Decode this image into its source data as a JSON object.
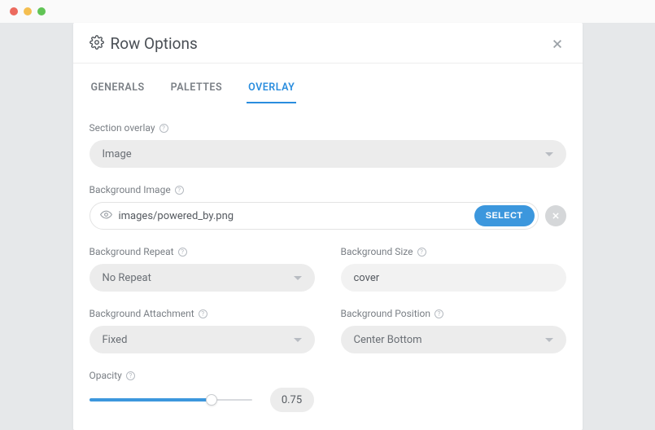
{
  "header": {
    "title": "Row Options"
  },
  "tabs": [
    {
      "label": "GENERALS",
      "active": false
    },
    {
      "label": "PALETTES",
      "active": false
    },
    {
      "label": "OVERLAY",
      "active": true
    }
  ],
  "fields": {
    "section_overlay": {
      "label": "Section overlay",
      "value": "Image"
    },
    "background_image": {
      "label": "Background Image",
      "value": "images/powered_by.png",
      "select_label": "SELECT"
    },
    "background_repeat": {
      "label": "Background Repeat",
      "value": "No Repeat"
    },
    "background_size": {
      "label": "Background Size",
      "value": "cover"
    },
    "background_attachment": {
      "label": "Background Attachment",
      "value": "Fixed"
    },
    "background_position": {
      "label": "Background Position",
      "value": "Center Bottom"
    },
    "opacity": {
      "label": "Opacity",
      "value": "0.75",
      "percent": 75
    }
  }
}
